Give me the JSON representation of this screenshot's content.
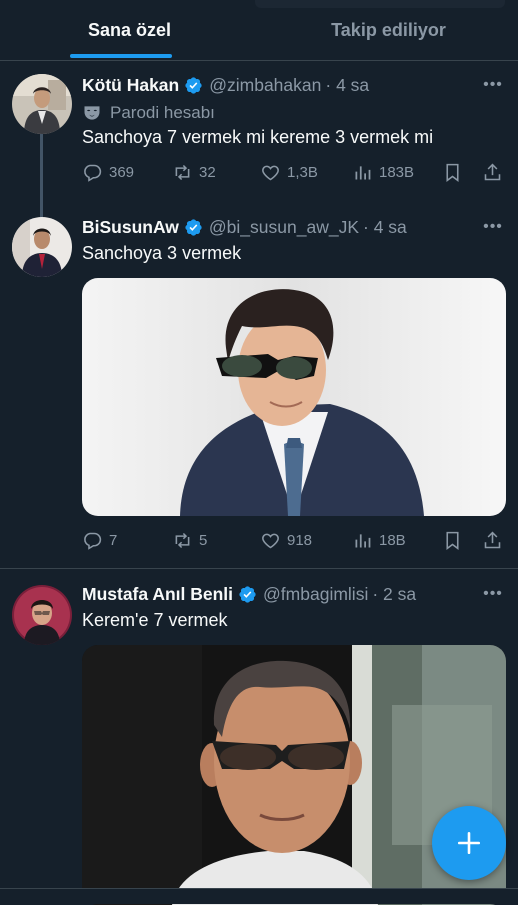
{
  "tabs": [
    {
      "label": "Sana özel",
      "active": true
    },
    {
      "label": "Takip ediliyor",
      "active": false
    }
  ],
  "colors": {
    "background": "#15202b",
    "accent": "#1d9bf0",
    "muted": "#8b98a5",
    "text": "#f7f9f9",
    "divider": "#38444d"
  },
  "tweets": [
    {
      "name": "Kötü Hakan",
      "verified": true,
      "handle": "@zimbahakan",
      "time": "· 4 sa",
      "badge": "Parodi hesabı",
      "badge_icon": "parody-mask-icon",
      "text": "Sanchoya 7 vermek mi kereme 3 vermek mi",
      "stats": {
        "replies": "369",
        "retweets": "32",
        "likes": "1,3B",
        "views": "183B"
      }
    },
    {
      "name": "BiSusunAw",
      "verified": true,
      "handle": "@bi_susun_aw_JK",
      "time": "· 4 sa",
      "text": "Sanchoya 3 vermek",
      "stats": {
        "replies": "7",
        "retweets": "5",
        "likes": "918",
        "views": "18B"
      }
    },
    {
      "name": "Mustafa Anıl Benli",
      "verified": true,
      "handle": "@fmbagimlisi",
      "time": "· 2 sa",
      "text": "Kerem'e 7 vermek"
    }
  ],
  "icons": [
    "reply-icon",
    "retweet-icon",
    "like-icon",
    "views-icon",
    "bookmark-icon",
    "share-icon",
    "more-icon",
    "verified-badge-icon",
    "compose-plus-icon"
  ]
}
